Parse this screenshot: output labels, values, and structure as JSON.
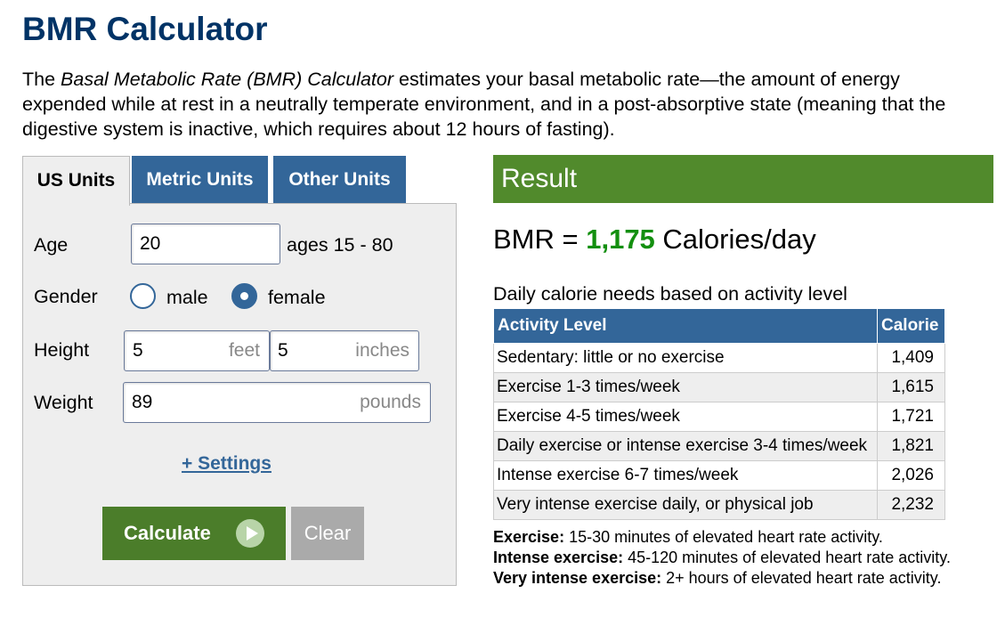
{
  "title": "BMR Calculator",
  "intro": {
    "prefix": "The ",
    "italic": "Basal Metabolic Rate (BMR) Calculator",
    "suffix": " estimates your basal metabolic rate—the amount of energy expended while at rest in a neutrally temperate environment, and in a post-absorptive state (meaning that the digestive system is inactive, which requires about 12 hours of fasting)."
  },
  "tabs": [
    "US Units",
    "Metric Units",
    "Other Units"
  ],
  "form": {
    "age_label": "Age",
    "age_value": "20",
    "age_hint": "ages 15 - 80",
    "gender_label": "Gender",
    "gender_male": "male",
    "gender_female": "female",
    "gender_selected": "female",
    "height_label": "Height",
    "height_feet": "5",
    "feet_unit": "feet",
    "height_inches": "5",
    "inches_unit": "inches",
    "weight_label": "Weight",
    "weight_value": "89",
    "weight_unit": "pounds",
    "settings_link": "+ Settings",
    "calculate": "Calculate",
    "clear": "Clear"
  },
  "result": {
    "header": "Result",
    "bmr_prefix": "BMR = ",
    "bmr_value": "1,175",
    "bmr_suffix": " Calories/day",
    "daily_title": "Daily calorie needs based on activity level",
    "table_headers": [
      "Activity Level",
      "Calorie"
    ],
    "rows": [
      {
        "activity": "Sedentary: little or no exercise",
        "calorie": "1,409"
      },
      {
        "activity": "Exercise 1-3 times/week",
        "calorie": "1,615"
      },
      {
        "activity": "Exercise 4-5 times/week",
        "calorie": "1,721"
      },
      {
        "activity": "Daily exercise or intense exercise 3-4 times/week",
        "calorie": "1,821"
      },
      {
        "activity": "Intense exercise 6-7 times/week",
        "calorie": "2,026"
      },
      {
        "activity": "Very intense exercise daily, or physical job",
        "calorie": "2,232"
      }
    ],
    "notes": [
      {
        "term": "Exercise:",
        "text": " 15-30 minutes of elevated heart rate activity."
      },
      {
        "term": "Intense exercise:",
        "text": " 45-120 minutes of elevated heart rate activity."
      },
      {
        "term": "Very intense exercise:",
        "text": " 2+ hours of elevated heart rate activity."
      }
    ]
  },
  "colors": {
    "title": "#003366",
    "tab_blue": "#336699",
    "result_green": "#518a2c",
    "bmr_value_green": "#138f0f",
    "calculate_green": "#4b7d2a",
    "clear_gray": "#aaaaaa"
  }
}
